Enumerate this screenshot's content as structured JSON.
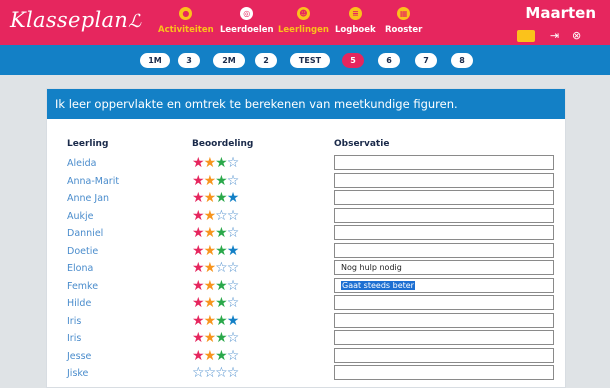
{
  "app": {
    "logo": "Klasseplan"
  },
  "nav": [
    {
      "label": "Activiteiten",
      "icon": "shapes-icon",
      "active": true
    },
    {
      "label": "Leerdoelen",
      "icon": "target-icon",
      "active": false
    },
    {
      "label": "Leerlingen",
      "icon": "students-icon",
      "active": true
    },
    {
      "label": "Logboek",
      "icon": "logbook-icon",
      "active": true
    },
    {
      "label": "Rooster",
      "icon": "calendar-icon",
      "active": true
    }
  ],
  "user": {
    "name": "Maarten"
  },
  "tabs": [
    "1M",
    "3",
    "2M",
    "2",
    "TEST",
    "5",
    "6",
    "7",
    "8"
  ],
  "active_tab": "5",
  "goal": {
    "title": "Ik leer oppervlakte en omtrek te berekenen van meetkundige figuren."
  },
  "columns": {
    "student": "Leerling",
    "rating": "Beoordeling",
    "observation": "Observatie"
  },
  "rows": [
    {
      "name": "Aleida",
      "rating": 3,
      "observation": ""
    },
    {
      "name": "Anna-Marit",
      "rating": 3,
      "observation": ""
    },
    {
      "name": "Anne Jan",
      "rating": 4,
      "observation": ""
    },
    {
      "name": "Aukje",
      "rating": 2,
      "observation": ""
    },
    {
      "name": "Danniel",
      "rating": 3,
      "observation": ""
    },
    {
      "name": "Doetie",
      "rating": 4,
      "observation": ""
    },
    {
      "name": "Elona",
      "rating": 2,
      "observation": "Nog hulp nodig"
    },
    {
      "name": "Femke",
      "rating": 3,
      "observation": "Gaat steeds beter",
      "selected": true
    },
    {
      "name": "Hilde",
      "rating": 3,
      "observation": ""
    },
    {
      "name": "Iris",
      "rating": 4,
      "observation": ""
    },
    {
      "name": "Iris",
      "rating": 3,
      "observation": ""
    },
    {
      "name": "Jesse",
      "rating": 3,
      "observation": ""
    },
    {
      "name": "Jiske",
      "rating": 0,
      "observation": ""
    }
  ],
  "star_colors": [
    "#e6265e",
    "#f7941d",
    "#2aa84a",
    "#1380c6"
  ],
  "empty_star_color": "#4a8ccc"
}
